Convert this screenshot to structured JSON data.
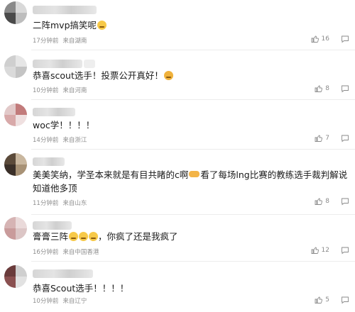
{
  "comments": [
    {
      "text": "二阵mvp搞笑呢",
      "time": "17分钟前",
      "location": "来自湖南",
      "likes": "16"
    },
    {
      "text": "恭喜scout选手！投票公开真好！",
      "time": "10分钟前",
      "location": "来自河南",
      "likes": "8"
    },
    {
      "text": "woc学！！！！",
      "time": "14分钟前",
      "location": "来自浙江",
      "likes": "7"
    },
    {
      "text_a": "美美笑纳，学圣本来就是有目共睹的c啊",
      "text_b": "看了每场lng比赛的教练选手裁判解说知道他多顶",
      "time": "11分钟前",
      "location": "来自山东",
      "likes": "8"
    },
    {
      "text_a": "膏膏三阵",
      "text_b": "，你疯了还是我疯了",
      "time": "16分钟前",
      "location": "来自中国香港",
      "likes": "12"
    },
    {
      "text": "恭喜Scout选手！！！！",
      "time": "10分钟前",
      "location": "来自辽宁",
      "likes": "5"
    }
  ],
  "icons": {
    "like": "thumbs-up-icon",
    "reply": "reply-icon",
    "emoji": "emoji-icon"
  },
  "colors": {
    "meta": "#8f8f8f",
    "divider": "#ececec"
  }
}
